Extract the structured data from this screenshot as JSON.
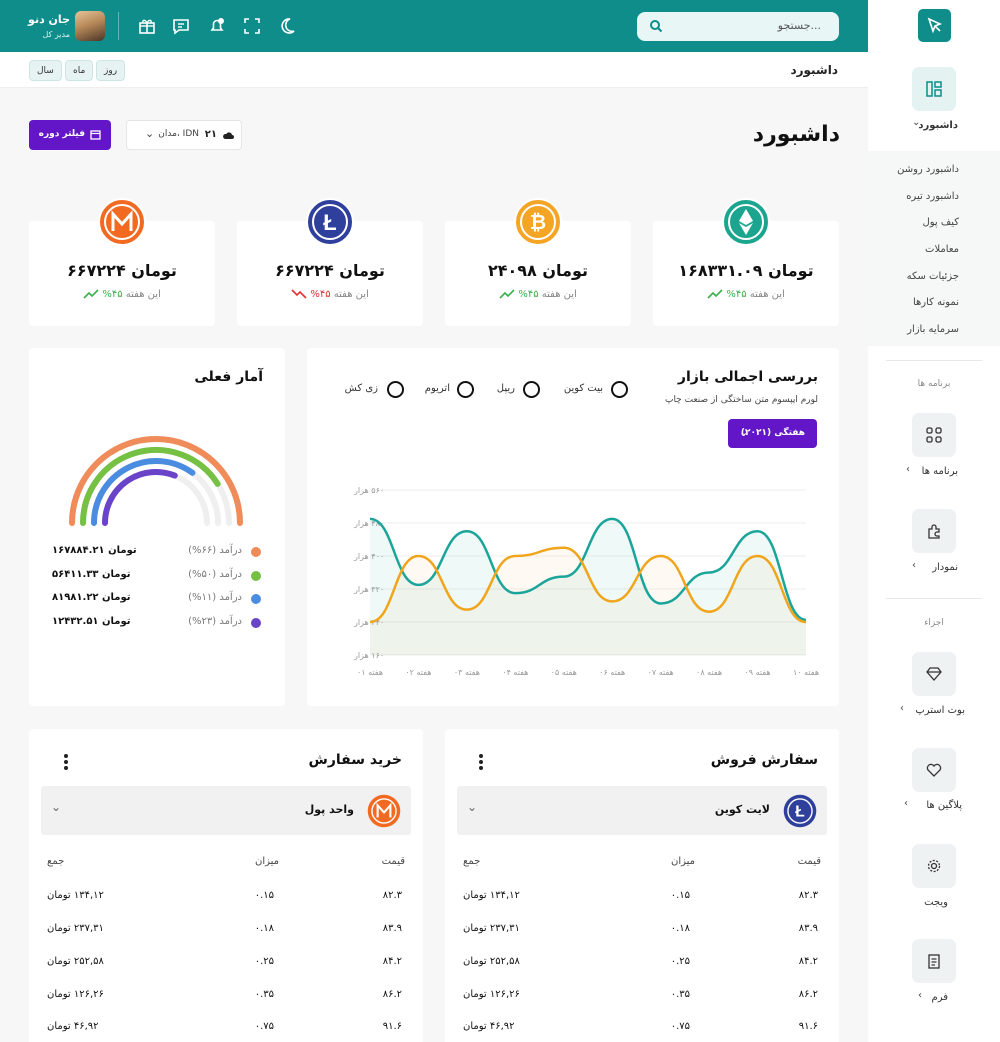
{
  "header": {
    "search_placeholder": "جستجو...",
    "user_name": "جان دنو",
    "user_role": "مدیر کل"
  },
  "subheader": {
    "breadcrumb": "داشبورد",
    "periods": [
      "روز",
      "ماه",
      "سال"
    ]
  },
  "page": {
    "title": "داشبورد",
    "filter_button": "فیلتر دوره",
    "weather_temp": "۲۱",
    "weather_location": "مدان، IDN"
  },
  "stats": [
    {
      "amount": "۱۶۸۳۳۱.۰۹ تومان",
      "pct": "۴۵%",
      "trend": "up",
      "period": "این هفته",
      "coin": "ethereum-classic",
      "color": "#1ba58e"
    },
    {
      "amount": "۲۴۰۹۸ تومان",
      "pct": "۴۵%",
      "trend": "up",
      "period": "این هفته",
      "coin": "bitcoin",
      "color": "#f5a524"
    },
    {
      "amount": "۶۶۷۲۲۴ تومان",
      "pct": "۴۵%",
      "trend": "down",
      "period": "این هفته",
      "coin": "litecoin",
      "color": "#2f3f9c"
    },
    {
      "amount": "۶۶۷۲۲۴ تومان",
      "pct": "۴۵%",
      "trend": "up",
      "period": "این هفته",
      "coin": "monero",
      "color": "#f26a22"
    }
  ],
  "market": {
    "title": "بررسی اجمالی بازار",
    "subtitle": "لورم ایپسوم متن ساختگی از صنعت چاپ",
    "coins": [
      "بیت کوین",
      "ریپل",
      "اتریوم",
      "زی کش"
    ],
    "week_button": "هفتگی (۲۰۲۱)"
  },
  "chart_data": {
    "type": "line",
    "x": [
      "هفته ۰۱",
      "هفته ۰۲",
      "هفته ۰۳",
      "هفته ۰۴",
      "هفته ۰۵",
      "هفته ۰۶",
      "هفته ۰۷",
      "هفته ۰۸",
      "هفته ۰۹",
      "هفته ۱۰"
    ],
    "ytick_labels": [
      "۱۶۰ هزار",
      "۲۴۰ هزار",
      "۳۲۰ هزار",
      "۴۰۰ هزار",
      "۴۸۰ هزار",
      "۵۶۰ هزار"
    ],
    "ylim": [
      160,
      560
    ],
    "grid": true,
    "series": [
      {
        "color": "#1ba59a",
        "values": [
          490,
          330,
          460,
          310,
          350,
          490,
          285,
          360,
          460,
          245
        ]
      },
      {
        "color": "#f0a51c",
        "values": [
          240,
          400,
          270,
          400,
          420,
          290,
          400,
          265,
          400,
          240
        ]
      }
    ]
  },
  "active_stats": {
    "title": "آمار فعلی",
    "rows": [
      {
        "value": "۱۶۷۸۸۴.۲۱ تومان",
        "label": "درآمد (۶۶%)",
        "color": "#f08c5a"
      },
      {
        "value": "۵۶۴۱۱.۳۳ تومان",
        "label": "درآمد (۵۰%)",
        "color": "#76c043"
      },
      {
        "value": "۸۱۹۸۱.۲۲ تومان",
        "label": "درآمد (۱۱%)",
        "color": "#4a8de0"
      },
      {
        "value": "۱۲۴۳۲.۵۱ تومان",
        "label": "درآمد (۲۳%)",
        "color": "#6a44c8"
      }
    ]
  },
  "orders": [
    {
      "title": "سفارش فروش",
      "currency": "لایت کوین",
      "columns": [
        "قیمت",
        "میزان",
        "جمع"
      ],
      "rows": [
        [
          "۸۲.۳",
          "۰.۱۵",
          "۱۳۴,۱۲ تومان"
        ],
        [
          "۸۳.۹",
          "۰.۱۸",
          "۲۳۷,۳۱ تومان"
        ],
        [
          "۸۴.۲",
          "۰.۲۵",
          "۲۵۲,۵۸ تومان"
        ],
        [
          "۸۶.۲",
          "۰.۳۵",
          "۱۲۶,۲۶ تومان"
        ],
        [
          "۹۱.۶",
          "۰.۷۵",
          "۴۶,۹۲ تومان"
        ]
      ]
    },
    {
      "title": "خرید سفارش",
      "currency": "واحد پول",
      "columns": [
        "قیمت",
        "میزان",
        "جمع"
      ],
      "rows": [
        [
          "۸۲.۳",
          "۰.۱۵",
          "۱۳۴,۱۲ تومان"
        ],
        [
          "۸۳.۹",
          "۰.۱۸",
          "۲۳۷,۳۱ تومان"
        ],
        [
          "۸۴.۲",
          "۰.۲۵",
          "۲۵۲,۵۸ تومان"
        ],
        [
          "۸۶.۲",
          "۰.۳۵",
          "۱۲۶,۲۶ تومان"
        ],
        [
          "۹۱.۶",
          "۰.۷۵",
          "۴۶,۹۲ تومان"
        ]
      ]
    }
  ],
  "sidebar": {
    "dashboard_label": "داشبورد",
    "submenu": [
      "داشبورد روشن",
      "داشبورد تیره",
      "کیف پول",
      "معاملات",
      "جزئیات سکه",
      "نمونه کارها",
      "سرمایه بازار"
    ],
    "section_apps": "برنامه ها",
    "apps_label": "برنامه ها",
    "chart_label": "نمودار",
    "section_parts": "اجزاء",
    "bootstrap_label": "بوت استرپ",
    "plugins_label": "پلاگین ها",
    "widget_label": "ویجت",
    "form_label": "فرم"
  }
}
